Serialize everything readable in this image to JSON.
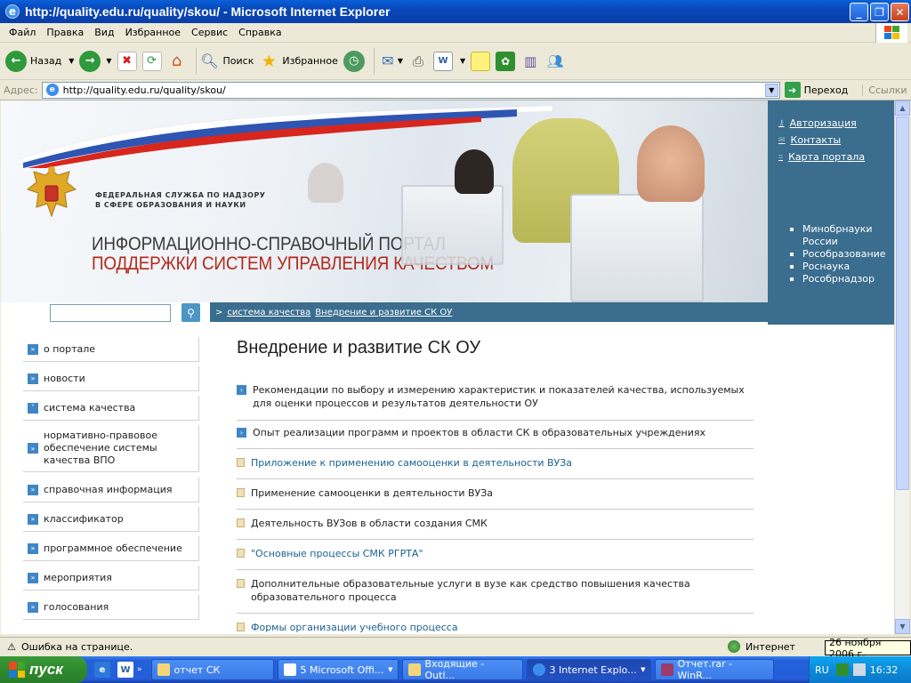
{
  "window": {
    "title": "http://quality.edu.ru/quality/skou/ - Microsoft Internet Explorer"
  },
  "menu": [
    "Файл",
    "Правка",
    "Вид",
    "Избранное",
    "Сервис",
    "Справка"
  ],
  "toolbar": {
    "back_label": "Назад",
    "search_label": "Поиск",
    "favorites_label": "Избранное"
  },
  "address": {
    "label": "Адрес:",
    "url": "http://quality.edu.ru/quality/skou/",
    "go_label": "Переход",
    "links_label": "Ссылки"
  },
  "site": {
    "agency_line1": "ФЕДЕРАЛЬНАЯ СЛУЖБА ПО НАДЗОРУ",
    "agency_line2": "В СФЕРЕ ОБРАЗОВАНИЯ И НАУКИ",
    "portal_line1": "ИНФОРМАЦИОННО-СПРАВОЧНЫЙ ПОРТАЛ",
    "portal_line2": "ПОДДЕРЖКИ СИСТЕМ УПРАВЛЕНИЯ КАЧЕСТВОМ",
    "top_links": [
      "Авторизация",
      "Контакты",
      "Карта портала"
    ],
    "org_links": [
      "Минобрнауки России",
      "Рособразование",
      "Роснаука",
      "Рособрнадзор"
    ],
    "search_placeholder": ""
  },
  "breadcrumb": {
    "prefix": ">",
    "items": [
      "система качества",
      "Внедрение и развитие СК ОУ"
    ]
  },
  "sidenav": [
    {
      "label": "о портале",
      "icon": "double-chevron-right-icon"
    },
    {
      "label": "новости",
      "icon": "double-chevron-right-icon"
    },
    {
      "label": "система качества",
      "icon": "chevron-down-icon"
    },
    {
      "label": "нормативно-правовое обеспечение системы качества ВПО",
      "icon": "double-chevron-right-icon"
    },
    {
      "label": "справочная информация",
      "icon": "double-chevron-right-icon"
    },
    {
      "label": "классификатор",
      "icon": "double-chevron-right-icon"
    },
    {
      "label": "программное обеспечение",
      "icon": "double-chevron-right-icon"
    },
    {
      "label": "мероприятия",
      "icon": "double-chevron-right-icon"
    },
    {
      "label": "голосования",
      "icon": "double-chevron-right-icon"
    }
  ],
  "content": {
    "title": "Внедрение и развитие СК ОУ",
    "items": [
      {
        "text": "Рекомендации по выбору и измерению характеристик и показателей качества, используемых для оценки процессов и результатов деятельности ОУ",
        "type": "section"
      },
      {
        "text": "Опыт реализации программ и проектов в области СК в образовательных учреждениях",
        "type": "section"
      },
      {
        "text": "Приложение к применению самооценки в деятельности ВУЗа",
        "type": "doc-link"
      },
      {
        "text": "Применение самооценки в деятельности ВУЗа",
        "type": "doc"
      },
      {
        "text": "Деятельность ВУЗов в области создания СМК",
        "type": "doc"
      },
      {
        "text": "\"Основные процессы СМК РГРТА\"",
        "type": "doc-link"
      },
      {
        "text": "Дополнительные образовательные услуги в вузе как средство повышения качества образовательного процесса",
        "type": "doc"
      },
      {
        "text": "Формы организации учебного процесса",
        "type": "doc-link"
      }
    ]
  },
  "status": {
    "text": "Ошибка на странице.",
    "zone": "Интернет",
    "tooltip": "26 ноября 2006 г."
  },
  "taskbar": {
    "start_label": "пуск",
    "tasks": [
      {
        "label": "отчет СК",
        "active": false
      },
      {
        "label": "5 Microsoft Offi...",
        "active": false
      },
      {
        "label": "Входящие - Outl...",
        "active": false
      },
      {
        "label": "3 Internet Explo...",
        "active": true
      },
      {
        "label": "Отчет.rar - WinR...",
        "active": false
      }
    ],
    "lang": "RU",
    "clock": "16:32"
  },
  "colors": {
    "xp_blue": "#0a5fd8",
    "portal_blue": "#3a6d8e",
    "portal_red": "#b12a1a",
    "link": "#1b6291",
    "start_green": "#3c9a3c"
  }
}
